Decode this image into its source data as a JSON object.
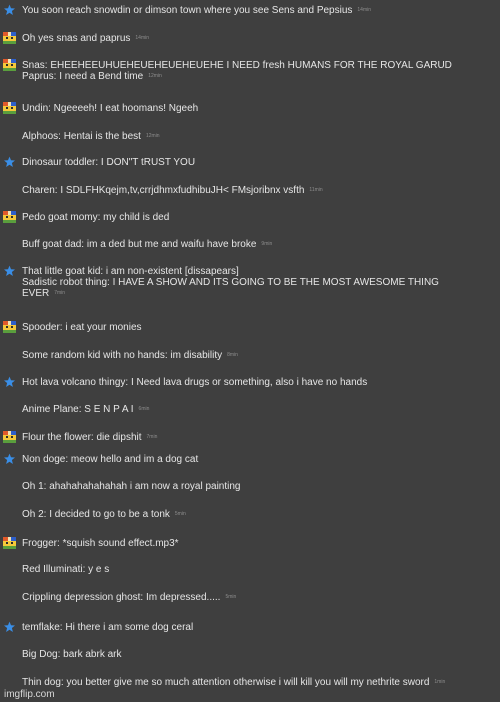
{
  "messages": [
    {
      "author_icon": "star-icon",
      "lines": [
        "You soon reach snowdin or dimson town where you see Sens and Pepsius"
      ],
      "time": "14min"
    },
    {
      "author_icon": "cat-avatar-icon",
      "lines": [
        "Oh yes snas and paprus"
      ],
      "time": "14min"
    },
    {
      "author_icon": "cat-avatar-icon",
      "lines": [
        "Snas: EHEEHEEUHUEHEUEHEUEHEUEHE I NEED fresh HUMANS FOR THE ROYAL GARUD",
        "Paprus: I need a Bend time"
      ],
      "time": "12min"
    },
    {
      "author_icon": "cat-avatar-icon",
      "lines": [
        "Undin: Ngeeeeh! I eat hoomans! Ngeeh"
      ],
      "time": ""
    },
    {
      "author_icon": "",
      "lines": [
        "Alphoos: Hentai is the best"
      ],
      "time": "12min"
    },
    {
      "author_icon": "star-icon",
      "lines": [
        "Dinosaur toddler: I DON\"T tRUST YOU"
      ],
      "time": ""
    },
    {
      "author_icon": "",
      "lines": [
        "Charen: I SDLFHKqejm,tv,crrjdhmxfudhibuJH< FMsjoribnx vsfth"
      ],
      "time": "11min"
    },
    {
      "author_icon": "cat-avatar-icon",
      "lines": [
        "Pedo goat momy: my child is ded"
      ],
      "time": ""
    },
    {
      "author_icon": "",
      "lines": [
        "Buff goat dad: im a ded but me and waifu have broke"
      ],
      "time": "9min"
    },
    {
      "author_icon": "star-icon",
      "lines": [
        "That little goat kid: i am non-existent [dissapears]",
        "Sadistic robot thing: I HAVE A SHOW AND ITS GOING TO BE THE MOST AWESOME THING",
        "EVER"
      ],
      "time": "7min"
    },
    {
      "author_icon": "cat-avatar-icon",
      "lines": [
        "Spooder: i eat your monies"
      ],
      "time": ""
    },
    {
      "author_icon": "",
      "lines": [
        "Some random kid with no hands: im disability"
      ],
      "time": "8min"
    },
    {
      "author_icon": "star-icon",
      "lines": [
        "Hot lava volcano thingy: I Need lava drugs or something, also i have no hands"
      ],
      "time": ""
    },
    {
      "author_icon": "",
      "lines": [
        "Anime Plane: S E N P A I"
      ],
      "time": "6min"
    },
    {
      "author_icon": "cat-avatar-icon",
      "lines": [
        "Flour the flower: die dipshit"
      ],
      "time": "7min"
    },
    {
      "author_icon": "star-icon",
      "lines": [
        "Non doge: meow hello and im a dog cat"
      ],
      "time": ""
    },
    {
      "author_icon": "",
      "lines": [
        "Oh 1: ahahahahahahah i am now a royal painting"
      ],
      "time": ""
    },
    {
      "author_icon": "",
      "lines": [
        "Oh 2: I decided to go to be a tonk"
      ],
      "time": "5min"
    },
    {
      "author_icon": "cat-avatar-icon",
      "lines": [
        "Frogger: *squish sound effect.mp3*"
      ],
      "time": ""
    },
    {
      "author_icon": "",
      "lines": [
        "Red Illuminati: y e s"
      ],
      "time": ""
    },
    {
      "author_icon": "",
      "lines": [
        "Crippling depression ghost: Im depressed....."
      ],
      "time": "5min"
    },
    {
      "author_icon": "star-icon",
      "lines": [
        "temflake: Hi there i am some dog ceral"
      ],
      "time": ""
    },
    {
      "author_icon": "",
      "lines": [
        "Big Dog: bark abrk ark"
      ],
      "time": ""
    },
    {
      "author_icon": "",
      "lines": [
        "Thin dog: you better give me so much attention otherwise i will kill you will my nethrite sword"
      ],
      "time": "1min"
    }
  ],
  "watermark": "imgflip.com",
  "colors": {
    "background": "#3f3f3f",
    "text": "#e6e6e6",
    "timestamp": "#8d8d8d",
    "star": "#3a8ee6"
  }
}
